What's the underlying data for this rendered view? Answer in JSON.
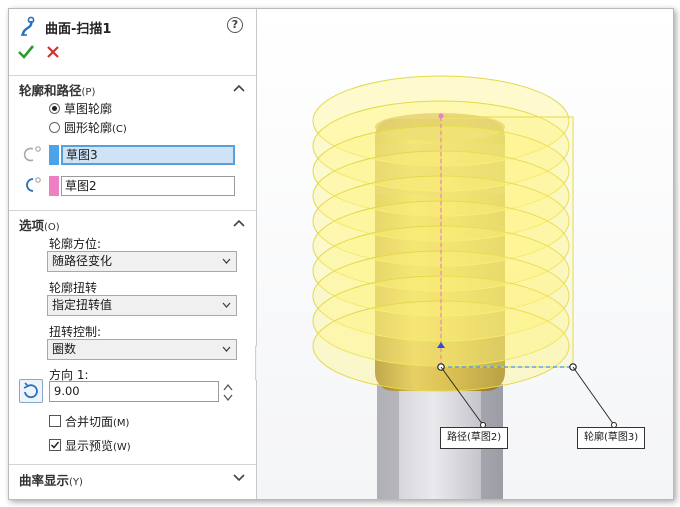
{
  "feature": {
    "title": "曲面-扫描1",
    "help": "?"
  },
  "sections": {
    "profile_path": {
      "header": "轮廓和路径",
      "mnemonic": "(P)",
      "radio_sketch_label": "草图轮廓",
      "radio_circular_label": "圆形轮廓",
      "radio_circular_mnemonic": "(C)",
      "profile_value": "草图3",
      "path_value": "草图2"
    },
    "options": {
      "header": "选项",
      "mnemonic": "(O)",
      "orientation_label": "轮廓方位:",
      "orientation_value": "随路径变化",
      "twist_label": "轮廓扭转",
      "twist_value": "指定扭转值",
      "twist_control_label": "扭转控制:",
      "twist_control_value": "圈数",
      "direction_label": "方向 1:",
      "direction_value": "9.00",
      "merge_label": "合并切面",
      "merge_mnemonic": "(M)",
      "merge_checked": false,
      "preview_label": "显示预览",
      "preview_mnemonic": "(W)",
      "preview_checked": true
    },
    "curvature": {
      "header": "曲率显示",
      "mnemonic": "(Y)"
    }
  },
  "viewport": {
    "callout_path": "路径(草图2)",
    "callout_profile": "轮廓(草图3)"
  },
  "colors": {
    "profile_swatch": "#4da3e8",
    "path_swatch": "#ef7fc3",
    "ok": "#2e9b2e",
    "cancel": "#d0312d",
    "preview_fill": "#fff580",
    "preview_stroke": "#e3d94a",
    "solid_body": "#c9a43a"
  }
}
